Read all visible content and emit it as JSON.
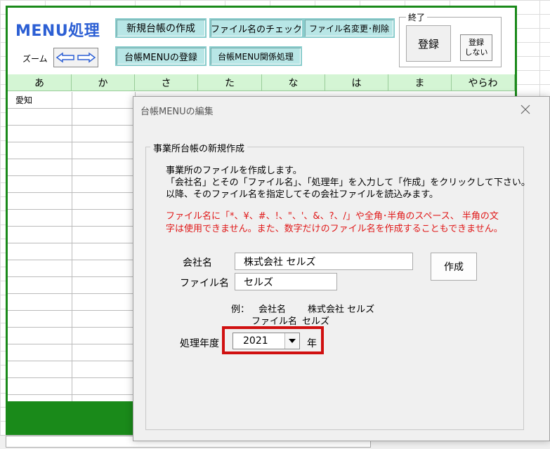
{
  "sheet": {
    "title": "MENU処理",
    "zoom_label": "ズーム",
    "buttons": {
      "new_ledger": "新規台帳の作成",
      "filename_check": "ファイル名のチェック",
      "rename_delete": "ファイル名変更･削除",
      "ledger_menu_register": "台帳MENUの登録",
      "ledger_menu_related": "台帳MENU関係処理"
    },
    "exit_group": {
      "legend": "終了",
      "register": "登録",
      "no_register_line1": "登録",
      "no_register_line2": "しない"
    },
    "columns": [
      "あ",
      "か",
      "さ",
      "た",
      "な",
      "は",
      "ま",
      "やらわ"
    ],
    "first_cell": "愛知"
  },
  "dialog": {
    "title": "台帳MENUの編集",
    "group_title": "事業所台帳の新規作成",
    "instructions": [
      "事業所のファイルを作成します。",
      "「会社名」とその「ファイル名」、「処理年」を入力して「作成」をクリックして下さい。",
      "以降、そのファイル名を指定してその会社ファイルを読込みます。"
    ],
    "warnings": [
      "ファイル名に「*、¥、#、!、\"、'、&、?、/」や全角･半角のスペース、 半角の文",
      "字は使用できません。また、数字だけのファイル名を作成することもできません。"
    ],
    "company_label": "会社名",
    "company_value": "株式会社  セルズ",
    "filename_label": "ファイル名",
    "filename_value": "セルズ",
    "create_button": "作成",
    "example_line1_prefix": "例：",
    "example_line1_label": "会社名",
    "example_line1_value": "株式会社  セルズ",
    "example_line2_label": "ファイル名",
    "example_line2_value": "セルズ",
    "year_label": "処理年度",
    "year_value": "2021",
    "year_suffix": "年"
  },
  "colors": {
    "frame_green": "#1a8a1a",
    "title_blue": "#2c5fd4",
    "button_teal": "#b8e6e6",
    "header_green": "#d4f5d4",
    "warning_red": "#e01818",
    "highlight_red": "#d01010"
  }
}
